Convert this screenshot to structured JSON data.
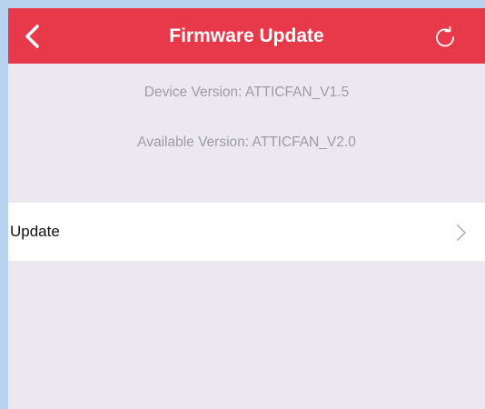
{
  "header": {
    "title": "Firmware Update",
    "back_icon": "chevron-left-icon",
    "refresh_icon": "refresh-icon"
  },
  "info": {
    "device_version": "Device Version: ATTICFAN_V1.5",
    "available_version": "Available Version: ATTICFAN_V2.0"
  },
  "actions": {
    "update_label": "Update",
    "update_chevron_icon": "chevron-right-icon"
  },
  "colors": {
    "accent": "#e8394a",
    "background": "#ebe8f0",
    "secondary_text": "#9d9ba3"
  }
}
